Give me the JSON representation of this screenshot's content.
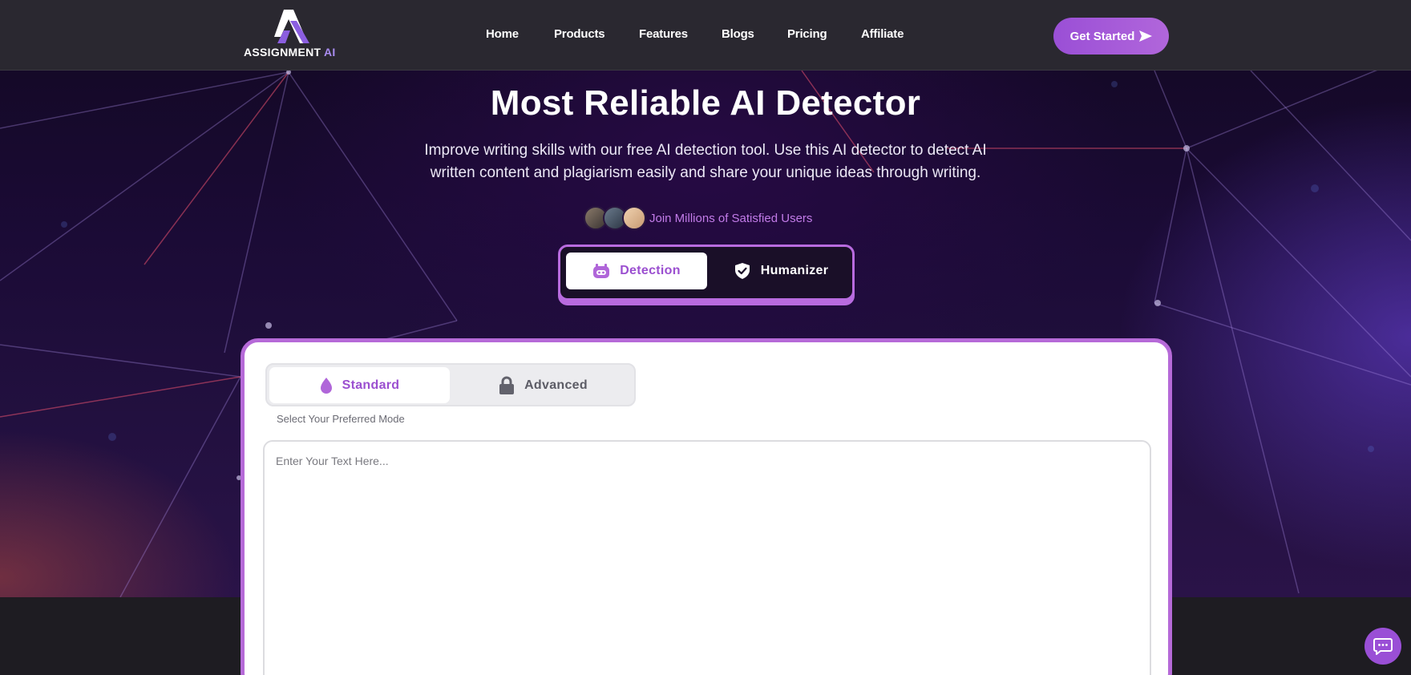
{
  "brand": {
    "name": "ASSIGNMENT",
    "suffix": "AI"
  },
  "nav": {
    "links": [
      "Home",
      "Products",
      "Features",
      "Blogs",
      "Pricing",
      "Affiliate"
    ],
    "cta_label": "Get Started",
    "cta_icon": "send-arrow-icon"
  },
  "hero": {
    "title": "Most Reliable AI Detector",
    "subtitle": "Improve writing skills with our free AI detection tool. Use this AI detector to detect AI written content and plagiarism easily and share your unique ideas through writing.",
    "social_proof": "Join Millions of Satisfied Users"
  },
  "tool_switch": {
    "options": [
      {
        "label": "Detection",
        "icon": "robot-icon",
        "selected": true
      },
      {
        "label": "Humanizer",
        "icon": "shield-check-icon",
        "selected": false
      }
    ]
  },
  "mode": {
    "options": [
      {
        "label": "Standard",
        "icon": "drop-icon",
        "selected": true
      },
      {
        "label": "Advanced",
        "icon": "lock-icon",
        "selected": false
      }
    ],
    "hint": "Select Your Preferred Mode"
  },
  "editor": {
    "placeholder": "Enter Your Text Here..."
  },
  "chat": {
    "icon": "chat-icon"
  },
  "colors": {
    "accent": "#b66ad8",
    "accent_dark": "#9b4fd0",
    "nav_bg": "#2a2830"
  }
}
